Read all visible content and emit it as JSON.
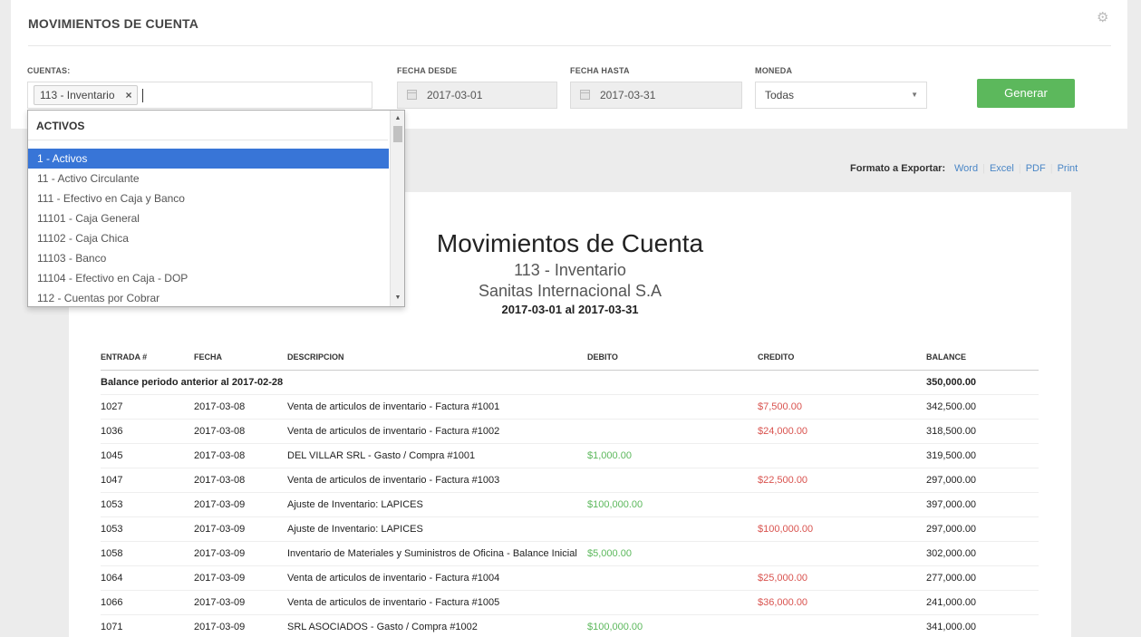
{
  "header": {
    "title": "MOVIMIENTOS DE CUENTA"
  },
  "filters": {
    "cuentas_label": "CUENTAS:",
    "selected_tag": "113 - Inventario",
    "tag_remove": "×",
    "fecha_desde_label": "FECHA DESDE",
    "fecha_desde": "2017-03-01",
    "fecha_hasta_label": "FECHA HASTA",
    "fecha_hasta": "2017-03-31",
    "moneda_label": "MONEDA",
    "moneda": "Todas",
    "generate_label": "Generar"
  },
  "dropdown": {
    "group": "ACTIVOS",
    "items": [
      "1 - Activos",
      "11 - Activo Circulante",
      "111 - Efectivo en Caja y Banco",
      "11101 - Caja General",
      "11102 - Caja Chica",
      "11103 - Banco",
      "11104 - Efectivo en Caja - DOP",
      "112 - Cuentas por Cobrar"
    ],
    "active_index": 0
  },
  "export": {
    "label": "Formato a Exportar:",
    "word": "Word",
    "excel": "Excel",
    "pdf": "PDF",
    "print": "Print"
  },
  "report": {
    "title": "Movimientos de Cuenta",
    "account": "113 - Inventario",
    "company": "Sanitas Internacional S.A",
    "dates": "2017-03-01 al 2017-03-31",
    "columns": [
      "ENTRADA #",
      "FECHA",
      "DESCRIPCION",
      "DEBITO",
      "CREDITO",
      "BALANCE"
    ],
    "previous_label": "Balance periodo anterior al 2017-02-28",
    "previous_balance": "350,000.00",
    "rows": [
      {
        "entrada": "1027",
        "fecha": "2017-03-08",
        "descripcion": "Venta de articulos de inventario - Factura #1001",
        "debito": "",
        "credito": "$7,500.00",
        "balance": "342,500.00"
      },
      {
        "entrada": "1036",
        "fecha": "2017-03-08",
        "descripcion": "Venta de articulos de inventario - Factura #1002",
        "debito": "",
        "credito": "$24,000.00",
        "balance": "318,500.00"
      },
      {
        "entrada": "1045",
        "fecha": "2017-03-08",
        "descripcion": "DEL VILLAR SRL - Gasto / Compra #1001",
        "debito": "$1,000.00",
        "credito": "",
        "balance": "319,500.00"
      },
      {
        "entrada": "1047",
        "fecha": "2017-03-08",
        "descripcion": "Venta de articulos de inventario - Factura #1003",
        "debito": "",
        "credito": "$22,500.00",
        "balance": "297,000.00"
      },
      {
        "entrada": "1053",
        "fecha": "2017-03-09",
        "descripcion": "Ajuste de Inventario: LAPICES",
        "debito": "$100,000.00",
        "credito": "",
        "balance": "397,000.00"
      },
      {
        "entrada": "1053",
        "fecha": "2017-03-09",
        "descripcion": "Ajuste de Inventario: LAPICES",
        "debito": "",
        "credito": "$100,000.00",
        "balance": "297,000.00"
      },
      {
        "entrada": "1058",
        "fecha": "2017-03-09",
        "descripcion": "Inventario de Materiales y Suministros de Oficina - Balance Inicial",
        "debito": "$5,000.00",
        "credito": "",
        "balance": "302,000.00"
      },
      {
        "entrada": "1064",
        "fecha": "2017-03-09",
        "descripcion": "Venta de articulos de inventario - Factura #1004",
        "debito": "",
        "credito": "$25,000.00",
        "balance": "277,000.00"
      },
      {
        "entrada": "1066",
        "fecha": "2017-03-09",
        "descripcion": "Venta de articulos de inventario - Factura #1005",
        "debito": "",
        "credito": "$36,000.00",
        "balance": "241,000.00"
      },
      {
        "entrada": "1071",
        "fecha": "2017-03-09",
        "descripcion": "SRL ASOCIADOS - Gasto / Compra #1002",
        "debito": "$100,000.00",
        "credito": "",
        "balance": "341,000.00"
      }
    ]
  }
}
